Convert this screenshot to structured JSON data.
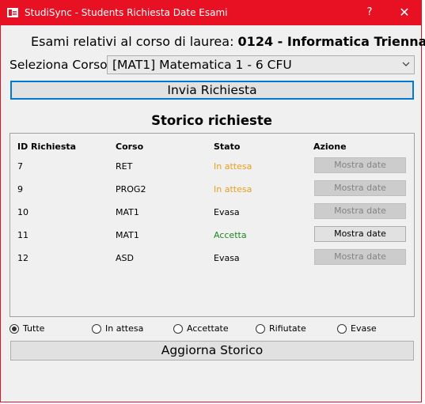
{
  "window": {
    "title": "StudiSync - Students Richiesta Date Esami",
    "help_glyph": "?",
    "close_glyph": "✕",
    "icon": "app-icon"
  },
  "header": {
    "prefix": "Esami relativi al corso di laurea: ",
    "degree_code": "0124",
    "separator": " - ",
    "degree_name": "Informatica Triennale"
  },
  "course": {
    "label": "Seleziona Corso:",
    "selected": "[MAT1] Matematica 1 - 6 CFU"
  },
  "send_button": "Invia Richiesta",
  "history": {
    "title": "Storico richieste",
    "columns": [
      "ID Richiesta",
      "Corso",
      "Stato",
      "Azione"
    ],
    "rows": [
      {
        "id": "7",
        "course": "RET",
        "status": "In attesa",
        "action": "Mostra date"
      },
      {
        "id": "9",
        "course": "PROG2",
        "status": "In attesa",
        "action": "Mostra date"
      },
      {
        "id": "10",
        "course": "MAT1",
        "status": "Evasa",
        "action": "Mostra date"
      },
      {
        "id": "11",
        "course": "MAT1",
        "status": "Accetta",
        "action": "Mostra date"
      },
      {
        "id": "12",
        "course": "ASD",
        "status": "Evasa",
        "action": "Mostra date"
      }
    ]
  },
  "filters": {
    "selected": "Tutte",
    "options": [
      "Tutte",
      "In attesa",
      "Accettate",
      "Rifiutate",
      "Evase"
    ]
  },
  "refresh_button": "Aggiorna Storico",
  "colors": {
    "titlebar": "#e81123",
    "pending": "#e6a020",
    "accepted": "#1a8a1a",
    "focus_border": "#0078d7"
  }
}
